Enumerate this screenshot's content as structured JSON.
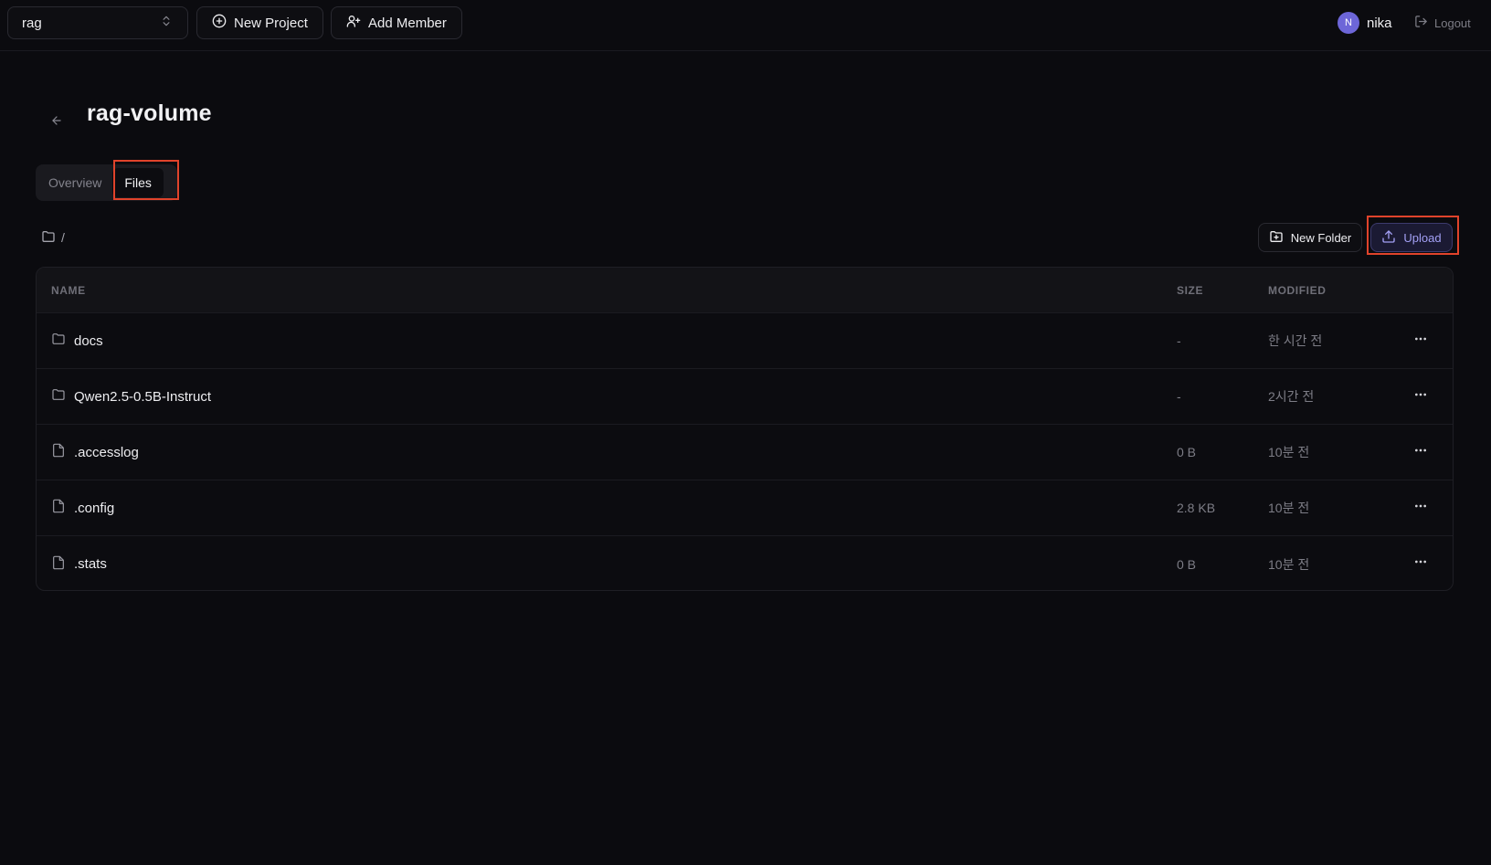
{
  "header": {
    "project_selector": {
      "value": "rag",
      "icon": "chevrons-up-down-icon"
    },
    "new_project_label": "New Project",
    "add_member_label": "Add Member",
    "user": {
      "avatar_initial": "N",
      "name": "nika",
      "avatar_color": "#6d66d8"
    },
    "logout_label": "Logout"
  },
  "page": {
    "title": "rag-volume",
    "tabs": [
      {
        "label": "Overview",
        "active": false
      },
      {
        "label": "Files",
        "active": true
      }
    ]
  },
  "toolbar": {
    "breadcrumb_path": "/",
    "new_folder_label": "New Folder",
    "upload_label": "Upload"
  },
  "table": {
    "headers": {
      "name": "NAME",
      "size": "SIZE",
      "modified": "MODIFIED"
    },
    "rows": [
      {
        "type": "folder",
        "name": "docs",
        "size": "-",
        "modified": "한 시간 전"
      },
      {
        "type": "folder",
        "name": "Qwen2.5-0.5B-Instruct",
        "size": "-",
        "modified": "2시간 전"
      },
      {
        "type": "file",
        "name": ".accesslog",
        "size": "0 B",
        "modified": "10분 전"
      },
      {
        "type": "file",
        "name": ".config",
        "size": "2.8 KB",
        "modified": "10분 전"
      },
      {
        "type": "file",
        "name": ".stats",
        "size": "0 B",
        "modified": "10분 전"
      }
    ]
  },
  "colors": {
    "background": "#0b0b0f",
    "accent": "#a3a0f5",
    "highlight": "#e0432b"
  }
}
